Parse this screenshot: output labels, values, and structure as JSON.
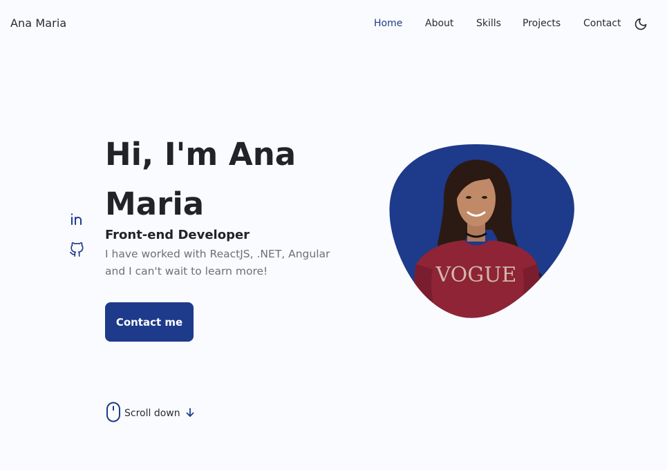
{
  "header": {
    "brand": "Ana Maria",
    "nav": [
      {
        "label": "Home",
        "active": true
      },
      {
        "label": "About"
      },
      {
        "label": "Skills"
      },
      {
        "label": "Projects"
      },
      {
        "label": "Contact"
      }
    ],
    "theme_icon": "moon-icon"
  },
  "social": {
    "linkedin_icon": "linkedin-icon",
    "github_icon": "github-icon"
  },
  "hero": {
    "title": "Hi, I'm Ana Maria",
    "subtitle": "Front-end Developer",
    "description": "I have worked with ReactJS, .NET, Angular and I can't wait to learn more!",
    "button_label": "Contact me"
  },
  "avatar": {
    "blob_color": "#1E3A8A",
    "icon": "profile-photo"
  },
  "scroll": {
    "label": "Scroll down",
    "mouse_icon": "mouse-icon",
    "arrow_icon": "arrow-down-icon"
  },
  "colors": {
    "accent": "#1E3A8A",
    "background": "#FAFBFE",
    "text": "#222229",
    "muted": "#6e6e78"
  }
}
